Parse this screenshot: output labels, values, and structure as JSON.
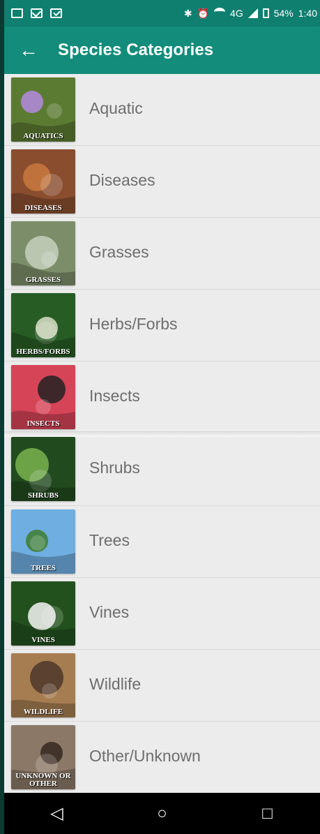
{
  "status": {
    "left_icons": [
      "image-icon",
      "mail-icon",
      "check-icon"
    ],
    "bluetooth": "✱",
    "alarm": "⏰",
    "network": "4G",
    "battery": "54%",
    "time": "1:40"
  },
  "app_bar": {
    "back": "←",
    "title": "Species Categories"
  },
  "categories": [
    {
      "label": "Aquatic",
      "caption": "AQUATICS",
      "color": "#5c7b32",
      "accent": "#b48adf"
    },
    {
      "label": "Diseases",
      "caption": "DISEASES",
      "color": "#8a4e2f",
      "accent": "#c8793d"
    },
    {
      "label": "Grasses",
      "caption": "GRASSES",
      "color": "#7c8d69",
      "accent": "#c6d0bd"
    },
    {
      "label": "Herbs/Forbs",
      "caption": "HERBS/FORBS",
      "color": "#275d25",
      "accent": "#d9dec5"
    },
    {
      "label": "Insects",
      "caption": "INSECTS",
      "color": "#d64458",
      "accent": "#222222"
    },
    {
      "label": "Shrubs",
      "caption": "SHRUBS",
      "color": "#214b1f",
      "accent": "#78b34e"
    },
    {
      "label": "Trees",
      "caption": "TREES",
      "color": "#6faee0",
      "accent": "#3f7c2e"
    },
    {
      "label": "Vines",
      "caption": "VINES",
      "color": "#23511e",
      "accent": "#f4f4f4"
    },
    {
      "label": "Wildlife",
      "caption": "WILDLIFE",
      "color": "#a67d51",
      "accent": "#4e3629"
    },
    {
      "label": "Other/Unknown",
      "caption": "UNKNOWN OR OTHER",
      "color": "#8b7866",
      "accent": "#352820"
    }
  ],
  "nav": {
    "back": "◁",
    "home": "○",
    "recent": "□"
  }
}
